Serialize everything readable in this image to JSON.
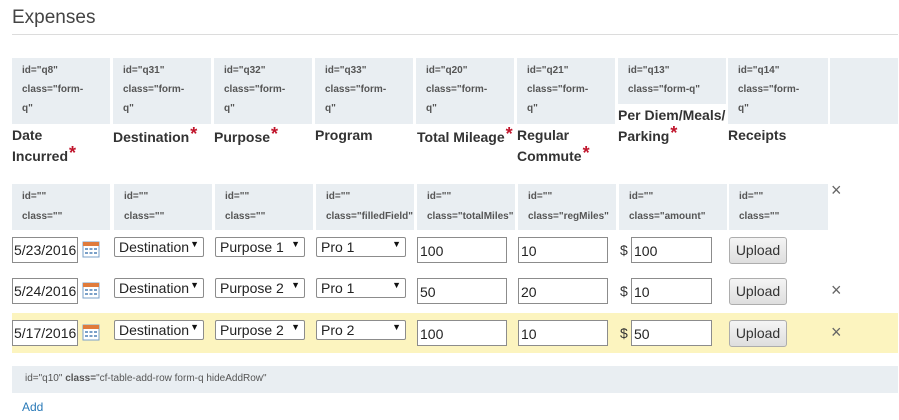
{
  "page": {
    "title": "Expenses"
  },
  "question_labels": [
    {
      "id": "id=\"q8\"",
      "class1": "class=\"form-",
      "class2": "q\""
    },
    {
      "id": "id=\"q31\"",
      "class1": "class=\"form-",
      "class2": "q\""
    },
    {
      "id": "id=\"q32\"",
      "class1": "class=\"form-",
      "class2": "q\""
    },
    {
      "id": "id=\"q33\"",
      "class1": "class=\"form-",
      "class2": "q\""
    },
    {
      "id": "id=\"q20\"",
      "class1": "class=\"form-",
      "class2": "q\""
    },
    {
      "id": "id=\"q21\"",
      "class1": "class=\"form-",
      "class2": "q\""
    },
    {
      "id": "id=\"q13\"",
      "class1": "class=\"form-q\"",
      "class2": ""
    },
    {
      "id": "id=\"q14\"",
      "class1": "class=\"form-",
      "class2": "q\""
    }
  ],
  "headers": {
    "date_line1": "Date",
    "date_line2": "Incurred",
    "destination": "Destination",
    "purpose": "Purpose",
    "program": "Program",
    "total_mileage": "Total Mileage",
    "regular_commute_line1": "Regular",
    "regular_commute_line2": "Commute",
    "per_diem_line1": "Per Diem/Meals/",
    "per_diem_line2": "Parking",
    "receipts": "Receipts",
    "required_mark": "*"
  },
  "field_labels": [
    {
      "id": "id=\"\"",
      "class": "class=\"\""
    },
    {
      "id": "id=\"\"",
      "class": "class=\"\""
    },
    {
      "id": "id=\"\"",
      "class": "class=\"\""
    },
    {
      "id": "id=\"\"",
      "class": "class=\"filledField\""
    },
    {
      "id": "id=\"\"",
      "class": "class=\"totalMiles\""
    },
    {
      "id": "id=\"\"",
      "class": "class=\"regMiles\""
    },
    {
      "id": "id=\"\"",
      "class": "class=\"amount\""
    },
    {
      "id": "id=\"\"",
      "class": "class=\"\""
    }
  ],
  "rows": [
    {
      "date": "5/23/2016",
      "destination": "Destination",
      "purpose": "Purpose 1",
      "program": "Pro 1",
      "total_mileage": "100",
      "regular_commute": "10",
      "currency": "$",
      "amount": "100",
      "upload_label": "Upload"
    },
    {
      "date": "5/24/2016",
      "destination": "Destination",
      "purpose": "Purpose 2",
      "program": "Pro 1",
      "total_mileage": "50",
      "regular_commute": "20",
      "currency": "$",
      "amount": "10",
      "upload_label": "Upload"
    },
    {
      "date": "5/17/2016",
      "destination": "Destination",
      "purpose": "Purpose 2",
      "program": "Pro 2",
      "total_mileage": "100",
      "regular_commute": "10",
      "currency": "$",
      "amount": "50",
      "upload_label": "Upload"
    }
  ],
  "remove_glyph": "×",
  "dropdown_arrow": "▼",
  "footer": {
    "id_attr": "id=\"q10\"",
    "class_key": "class=",
    "class_value": "\"cf-table-add-row form-q hideAddRow\""
  },
  "add_link": "Add",
  "colors": {
    "required": "#c0142b",
    "highlight_row": "#fcf4bf",
    "header_bg": "#e9eef2",
    "link": "#2a7ab8"
  }
}
